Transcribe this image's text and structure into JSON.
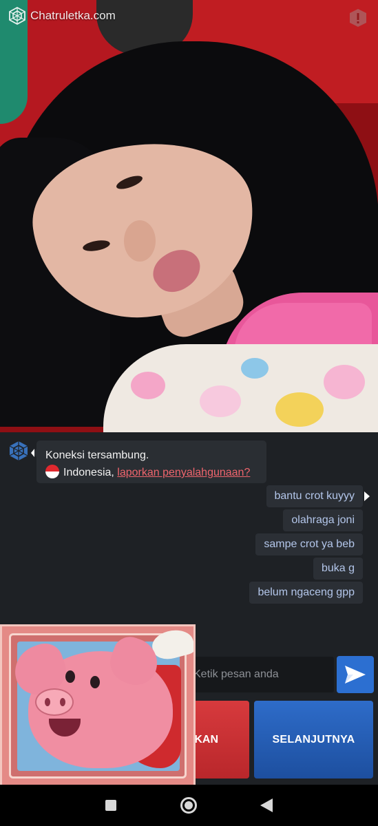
{
  "app": {
    "brand": "Chatruletka.com"
  },
  "chat": {
    "system_message": {
      "status": "Koneksi tersambung.",
      "country": "Indonesia,",
      "report_link": "laporkan penyalahgunaan?"
    },
    "messages": [
      {
        "text": "bantu crot kuyyy"
      },
      {
        "text": "olahraga joni"
      },
      {
        "text": "sampe crot ya beb"
      },
      {
        "text": "buka g"
      },
      {
        "text": "belum ngaceng gpp"
      }
    ]
  },
  "composer": {
    "placeholder": "Ketik pesan anda"
  },
  "actions": {
    "stop_label": "KAN",
    "next_label": "SELANJUTNYA"
  },
  "colors": {
    "background": "#1e2125",
    "bubble": "#2b2f35",
    "message_text": "#b3c6ea",
    "link": "#f0656d",
    "send": "#2c6fd1",
    "stop": "#c9302c",
    "next": "#2860b8"
  },
  "icons": [
    "chatruletka-logo-icon",
    "report-shield-icon",
    "send-arrow-icon",
    "recents-icon",
    "home-icon",
    "back-icon"
  ]
}
